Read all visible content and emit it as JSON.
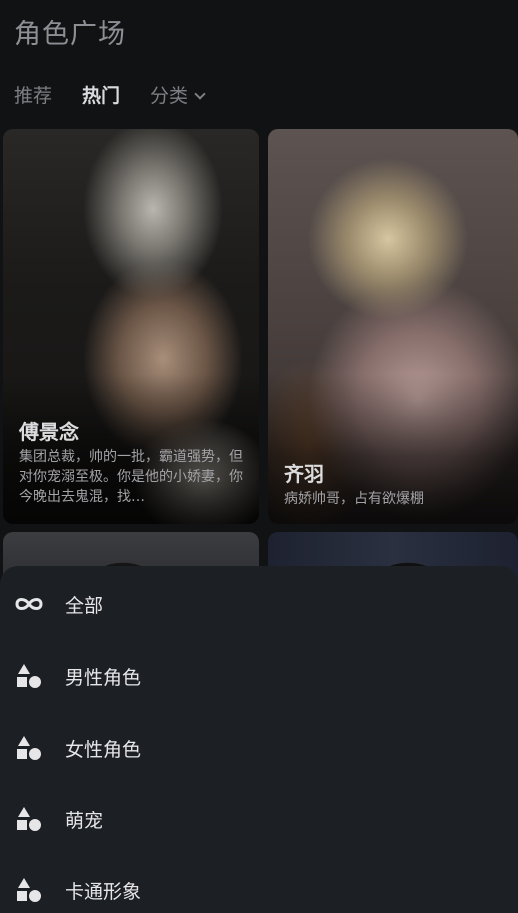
{
  "page": {
    "title": "角色广场"
  },
  "tabs": [
    {
      "label": "推荐"
    },
    {
      "label": "热门"
    },
    {
      "label": "分类"
    }
  ],
  "cards": [
    {
      "name": "傅景念",
      "desc": "集团总裁，帅的一批，霸道强势，但对你宠溺至极。你是他的小娇妻，你今晚出去鬼混，找…"
    },
    {
      "name": "齐羽",
      "desc": "病娇帅哥，占有欲爆棚"
    }
  ],
  "categories": [
    {
      "label": "全部",
      "icon": "infinity-icon"
    },
    {
      "label": "男性角色",
      "icon": "shapes-icon"
    },
    {
      "label": "女性角色",
      "icon": "shapes-icon"
    },
    {
      "label": "萌宠",
      "icon": "shapes-icon"
    },
    {
      "label": "卡通形象",
      "icon": "shapes-icon"
    }
  ],
  "colors": {
    "background": "#111214",
    "sheet": "#1c1f24",
    "active_tab": "#d9dade",
    "inactive_tab": "#7d7e83"
  }
}
